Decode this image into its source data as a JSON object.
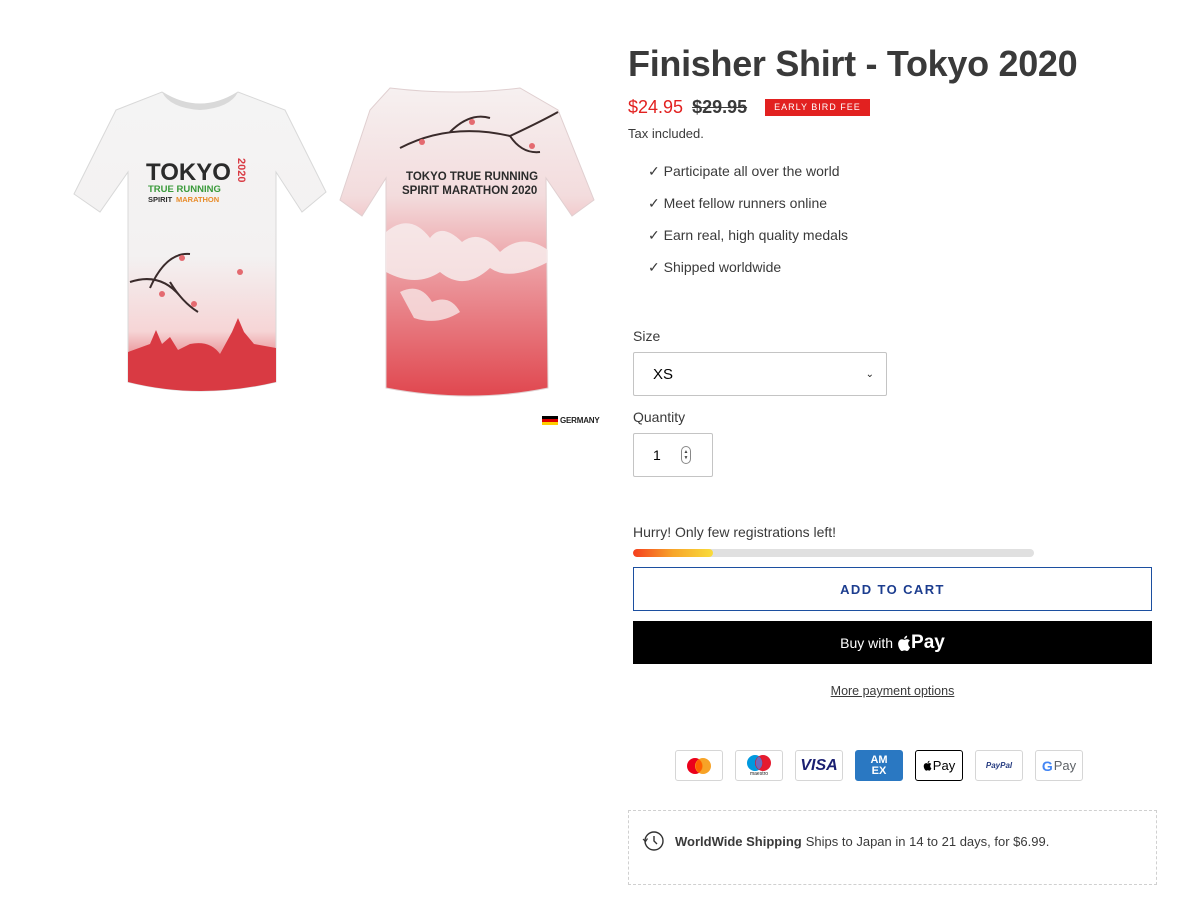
{
  "product": {
    "title": "Finisher Shirt - Tokyo 2020",
    "sale_price": "$24.95",
    "compare_price": "$29.95",
    "badge": "EARLY BIRD FEE",
    "tax_note": "Tax included.",
    "features": [
      "✓ Participate all over the world",
      "✓ Meet fellow runners online",
      "✓ Earn real, high quality medals",
      "✓ Shipped worldwide"
    ]
  },
  "image": {
    "front_text_line1": "TOKYO",
    "front_text_line2": "TRUE RUNNING",
    "front_text_line3a": "SPIRIT",
    "front_text_line3b": "MARATHON",
    "front_year": "2020",
    "back_text_line1": "TOKYO TRUE RUNNING",
    "back_text_line2": "SPIRIT MARATHON 2020",
    "made_in": "GERMANY"
  },
  "form": {
    "size_label": "Size",
    "size_value": "XS",
    "quantity_label": "Quantity",
    "quantity_value": "1"
  },
  "stock": {
    "message": "Hurry! Only few registrations left!",
    "level_percent": 20
  },
  "buttons": {
    "add_to_cart": "ADD TO CART",
    "buy_with": "Buy with",
    "pay": "Pay",
    "more_options": "More payment options"
  },
  "payment_icons": [
    "mastercard-icon",
    "maestro-icon",
    "visa-icon",
    "amex-icon",
    "apple-pay-icon",
    "paypal-icon",
    "google-pay-icon"
  ],
  "payment_text": {
    "maestro": "maestro",
    "visa": "VISA",
    "amex_top": "AM",
    "amex_bottom": "EX",
    "apple_pay": "Pay",
    "paypal": "PayPal",
    "gpay": "Pay"
  },
  "shipping": {
    "title": "WorldWide Shipping",
    "text": "Ships to Japan in 14 to 21 days, for $6.99."
  },
  "colors": {
    "sale": "#e22120",
    "button_text": "#1c3d8f",
    "shirt_red": "#e0474f"
  }
}
